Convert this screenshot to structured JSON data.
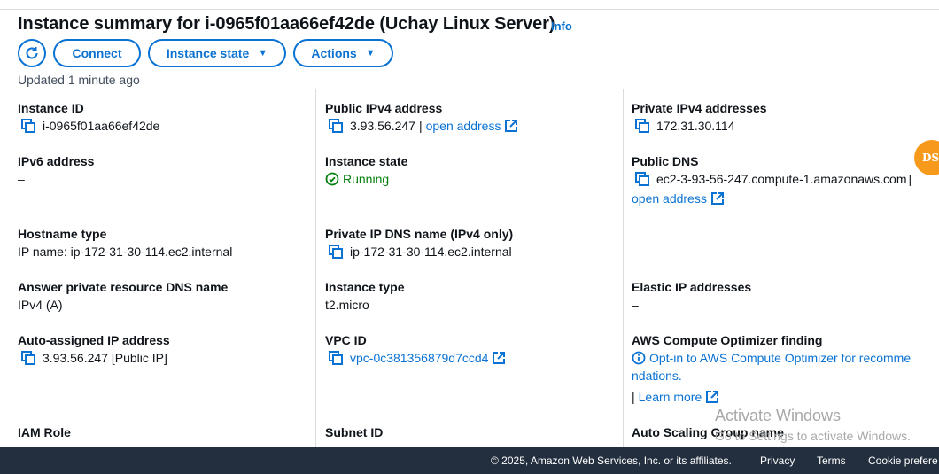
{
  "header": {
    "title": "Instance summary for i-0965f01aa66ef42de (Uchay Linux Server)",
    "info_label": "Info",
    "connect_label": "Connect",
    "instance_state_label": "Instance state",
    "actions_label": "Actions",
    "updated": "Updated 1 minute ago"
  },
  "fields": {
    "instance_id": {
      "label": "Instance ID",
      "value": "i-0965f01aa66ef42de"
    },
    "public_ipv4": {
      "label": "Public IPv4 address",
      "value": "3.93.56.247",
      "sep": "|",
      "link": "open address"
    },
    "private_ipv4": {
      "label": "Private IPv4 addresses",
      "value": "172.31.30.114"
    },
    "ipv6": {
      "label": "IPv6 address",
      "value": "–"
    },
    "instance_state": {
      "label": "Instance state",
      "value": "Running"
    },
    "public_dns": {
      "label": "Public DNS",
      "value": "ec2-3-93-56-247.compute-1.amazonaws.com",
      "sep": "|",
      "link": "open address"
    },
    "hostname_type": {
      "label": "Hostname type",
      "value": "IP name: ip-172-31-30-114.ec2.internal"
    },
    "private_ip_dns": {
      "label": "Private IP DNS name (IPv4 only)",
      "value": "ip-172-31-30-114.ec2.internal"
    },
    "answer_dns": {
      "label": "Answer private resource DNS name",
      "value": "IPv4 (A)"
    },
    "instance_type": {
      "label": "Instance type",
      "value": "t2.micro"
    },
    "elastic_ip": {
      "label": "Elastic IP addresses",
      "value": "–"
    },
    "auto_ip": {
      "label": "Auto-assigned IP address",
      "value": "3.93.56.247 [Public IP]"
    },
    "vpc_id": {
      "label": "VPC ID",
      "value": "vpc-0c381356879d7ccd4"
    },
    "optimizer": {
      "label": "AWS Compute Optimizer finding",
      "line1": "Opt-in to AWS Compute Optimizer for recomme",
      "line2": "ndations.",
      "sep": "|",
      "learn": "Learn more"
    },
    "iam_role": {
      "label": "IAM Role"
    },
    "subnet_id": {
      "label": "Subnet ID"
    },
    "asg_name": {
      "label": "Auto Scaling Group name"
    }
  },
  "footer": {
    "copyright": "© 2025, Amazon Web Services, Inc. or its affiliates.",
    "privacy": "Privacy",
    "terms": "Terms",
    "cookie": "Cookie prefere"
  },
  "watermark": {
    "line1": "Activate Windows",
    "line2": "Go to Settings to activate Windows."
  },
  "badge": {
    "text": "DS"
  },
  "colors": {
    "link": "#0972d3",
    "running": "#037f0c",
    "footer_bg": "#232f3e",
    "badge": "#f79a1c"
  }
}
